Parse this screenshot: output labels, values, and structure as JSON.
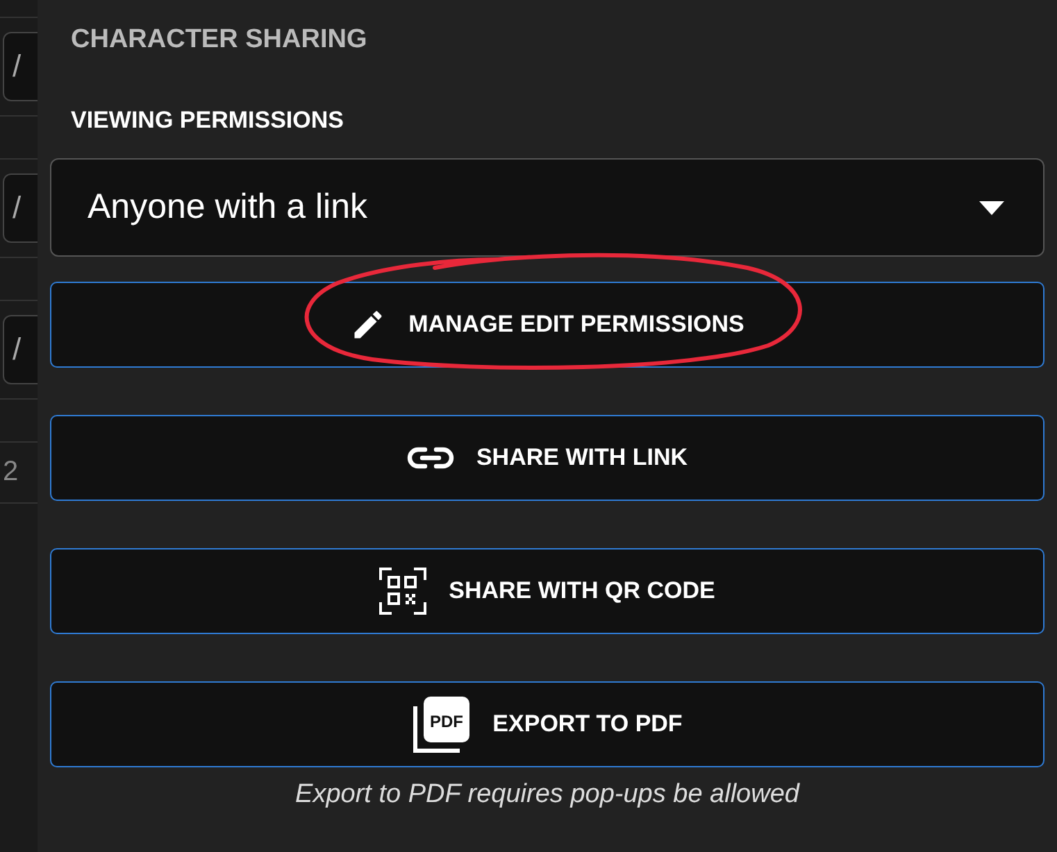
{
  "background_strip": [
    {
      "kind": "field",
      "value": "/"
    },
    {
      "kind": "field",
      "value": "/"
    },
    {
      "kind": "field",
      "value": "/"
    },
    {
      "kind": "text",
      "value": "2"
    }
  ],
  "panel": {
    "title": "CHARACTER SHARING",
    "viewing_permissions": {
      "label": "VIEWING PERMISSIONS",
      "value": "Anyone with a link"
    },
    "buttons": [
      {
        "kind": "pencil",
        "label": "MANAGE EDIT PERMISSIONS",
        "highlighted": true
      },
      {
        "kind": "link",
        "label": "SHARE WITH LINK",
        "highlighted": false
      },
      {
        "kind": "qr",
        "label": "SHARE WITH QR CODE",
        "highlighted": false
      },
      {
        "kind": "pdf",
        "icon_text": "PDF",
        "label": "EXPORT TO PDF",
        "highlighted": false
      }
    ],
    "note": "Export to PDF requires pop-ups be allowed"
  }
}
